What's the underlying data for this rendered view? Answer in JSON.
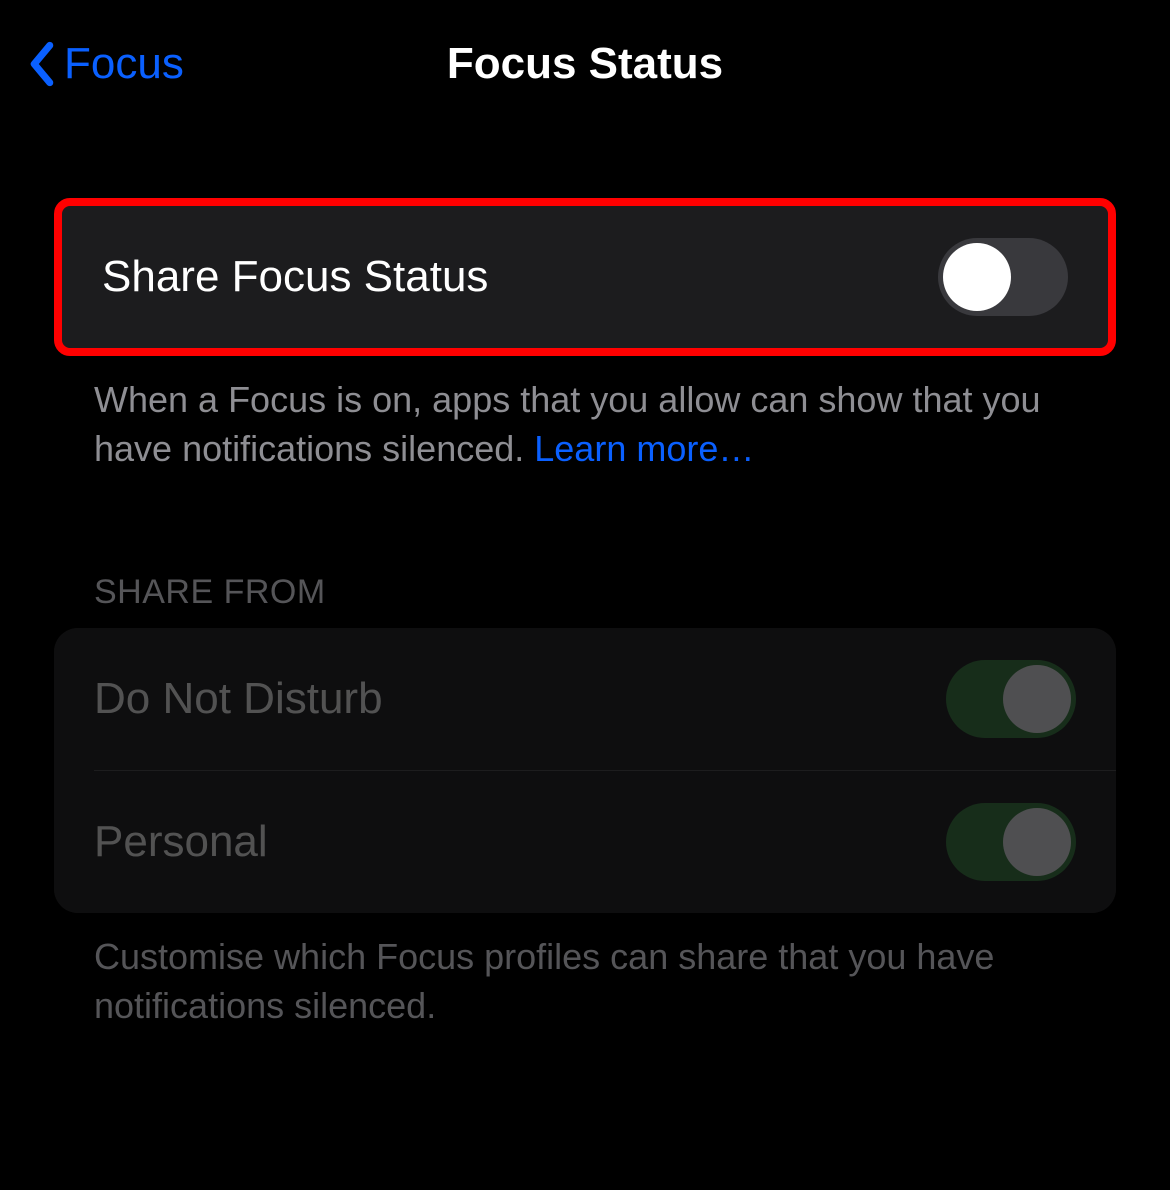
{
  "nav": {
    "back_label": "Focus",
    "title": "Focus Status"
  },
  "share_status": {
    "label": "Share Focus Status",
    "enabled": false,
    "footer_text": "When a Focus is on, apps that you allow can show that you have notifications silenced. ",
    "learn_more": "Learn more…"
  },
  "share_from": {
    "header": "SHARE FROM",
    "items": [
      {
        "label": "Do Not Disturb",
        "enabled": true
      },
      {
        "label": "Personal",
        "enabled": true
      }
    ],
    "footer_text": "Customise which Focus profiles can share that you have notifications silenced."
  },
  "colors": {
    "accent_blue": "#0A60FF",
    "switch_on": "#2F5B35",
    "switch_off": "#39393D",
    "group_bg": "#1C1C1E",
    "secondary_text": "#8E8E93",
    "highlight_red": "#FF0000"
  }
}
